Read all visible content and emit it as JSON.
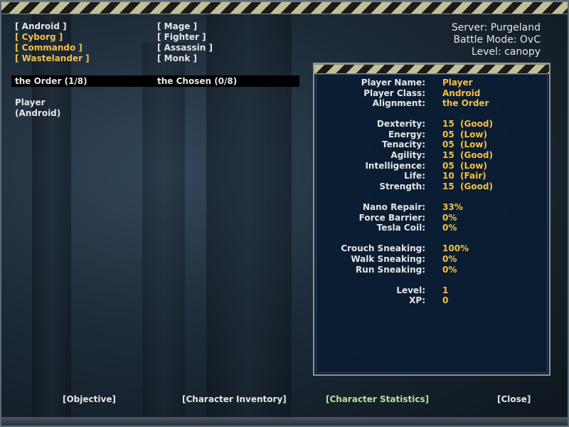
{
  "classes": {
    "left": [
      {
        "label": "[ Android ]",
        "selected": false
      },
      {
        "label": "[ Cyborg ]",
        "selected": true
      },
      {
        "label": "[ Commando ]",
        "selected": true
      },
      {
        "label": "[ Wastelander ]",
        "selected": true
      }
    ],
    "right": [
      {
        "label": "[ Mage ]",
        "selected": false
      },
      {
        "label": "[ Fighter ]",
        "selected": false
      },
      {
        "label": "[ Assassin ]",
        "selected": false
      },
      {
        "label": "[ Monk ]",
        "selected": false
      }
    ]
  },
  "server": {
    "server_line": "Server: Purgeland",
    "mode_line": "Battle Mode: OvC",
    "level_line": "Level: canopy"
  },
  "teams": {
    "order": "the Order (1/8)",
    "chosen": "the Chosen (0/8)"
  },
  "player_entry": {
    "name": "Player",
    "class": "(Android)"
  },
  "stats": {
    "player_name_label": "Player Name:",
    "player_name_value": "Player",
    "player_class_label": "Player Class:",
    "player_class_value": "Android",
    "alignment_label": "Alignment:",
    "alignment_value": "the Order",
    "dexterity_label": "Dexterity:",
    "dexterity_value": "15  (Good)",
    "energy_label": "Energy:",
    "energy_value": "05  (Low)",
    "tenacity_label": "Tenacity:",
    "tenacity_value": "05  (Low)",
    "agility_label": "Agility:",
    "agility_value": "15  (Good)",
    "intelligence_label": "Intelligence:",
    "intelligence_value": "05  (Low)",
    "life_label": "Life:",
    "life_value": "10  (Fair)",
    "strength_label": "Strength:",
    "strength_value": "15  (Good)",
    "nano_repair_label": "Nano Repair:",
    "nano_repair_value": "33%",
    "force_barrier_label": "Force Barrier:",
    "force_barrier_value": "0%",
    "tesla_coil_label": "Tesla Coil:",
    "tesla_coil_value": "0%",
    "crouch_sneaking_label": "Crouch Sneaking:",
    "crouch_sneaking_value": "100%",
    "walk_sneaking_label": "Walk Sneaking:",
    "walk_sneaking_value": "0%",
    "run_sneaking_label": "Run Sneaking:",
    "run_sneaking_value": "0%",
    "level_label": "Level:",
    "level_value": "1",
    "xp_label": "XP:",
    "xp_value": "0"
  },
  "nav": {
    "objective": "[Objective]",
    "inventory": "[Character Inventory]",
    "statistics": "[Character Statistics]",
    "close": "[Close]"
  },
  "colors": {
    "highlight": "#f4c048",
    "active_tab": "#b5e3a0",
    "text": "#e6e6e6",
    "panel_bg": "#0a1c32"
  }
}
